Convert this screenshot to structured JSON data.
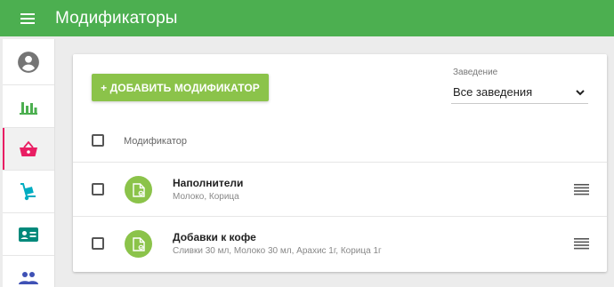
{
  "appbar": {
    "title": "Модификаторы",
    "menu_icon": "hamburger-menu-icon"
  },
  "sidebar": {
    "items": [
      {
        "name": "account",
        "icon": "account-circle-icon",
        "color": "#757575",
        "active": false
      },
      {
        "name": "statistics",
        "icon": "bar-chart-icon",
        "color": "#4caf50",
        "active": false
      },
      {
        "name": "menu",
        "icon": "basket-icon",
        "color": "#e91e63",
        "active": true
      },
      {
        "name": "delivery",
        "icon": "hand-truck-icon",
        "color": "#00acc1",
        "active": false
      },
      {
        "name": "cards",
        "icon": "id-card-icon",
        "color": "#00897b",
        "active": false
      },
      {
        "name": "users",
        "icon": "people-icon",
        "color": "#3f51b5",
        "active": false
      }
    ]
  },
  "toolbar": {
    "add_label": "+ ДОБАВИТЬ МОДИФИКАТОР"
  },
  "venue": {
    "label": "Заведение",
    "value": "Все заведения"
  },
  "table": {
    "header": "Модификатор",
    "rows": [
      {
        "title": "Наполнители",
        "subtitle": "Молоко, Корица"
      },
      {
        "title": "Добавки к кофе",
        "subtitle": "Сливки 30 мл, Молоко 30 мл, Арахис 1г, Корица 1г"
      }
    ]
  },
  "colors": {
    "appbar": "#4caf50",
    "accent": "#8bc34a",
    "active_indicator": "#e91e63"
  }
}
